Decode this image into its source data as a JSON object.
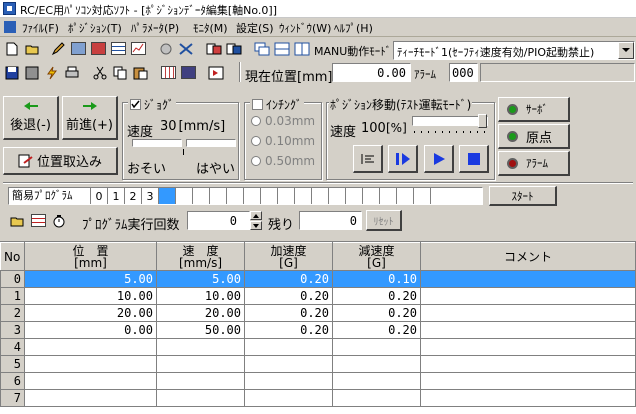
{
  "window": {
    "title": "RC/EC用ﾊﾟｿｺﾝ対応ｿﾌﾄ - [ﾎﾟｼﾞｼｮﾝﾃﾞｰﾀ編集[軸No.0]]"
  },
  "menu": [
    "ﾌｧｲﾙ(F)",
    "ﾎﾟｼﾞｼｮﾝ(T)",
    "ﾊﾟﾗﾒｰﾀ(P)",
    "ﾓﾆﾀ(M)",
    "設定(S)",
    "ｳｨﾝﾄﾞｳ(W)",
    "ﾍﾙﾌﾟ(H)"
  ],
  "toolbar": {
    "manu_mode_label": "MANU動作ﾓｰﾄﾞ",
    "manu_mode_value": "ﾃｨｰﾁﾓｰﾄﾞ1(ｾｰﾌﾃｨ速度有効/PIO起動禁止)",
    "position_label": "現在位置[mm]",
    "position_value": "0.00",
    "alarm_label": "ｱﾗｰﾑ",
    "alarm_value": "000"
  },
  "jog": {
    "back_label": "後退(-)",
    "fwd_label": "前進(+)",
    "fetch_label": "位置取込み",
    "jog_check_label": "ｼﾞｮｸﾞ",
    "speed_label": "速度",
    "speed_value": "30",
    "speed_unit": "[mm/s]",
    "slow_label": "おそい",
    "fast_label": "はやい"
  },
  "inching": {
    "label": "ｲﾝﾁﾝｸﾞ",
    "options": [
      "0.03mm",
      "0.10mm",
      "0.50mm"
    ]
  },
  "posmove": {
    "title": "ﾎﾟｼﾞｼｮﾝ移動(ﾃｽﾄ運転ﾓｰﾄﾞ)",
    "speed_label": "速度",
    "speed_value": "100",
    "speed_unit": "[%]"
  },
  "status": {
    "servo_label": "ｻｰﾎﾞ",
    "origin_label": "原点",
    "alarm_label": "ｱﾗｰﾑ",
    "led_green": "#1a9a1a",
    "led_red": "#a01010"
  },
  "program": {
    "label": "簡易ﾌﾟﾛｸﾞﾗﾑ",
    "steps": [
      "0",
      "1",
      "2",
      "3"
    ],
    "start_label": "ｽﾀｰﾄ",
    "exec_count_label": "ﾌﾟﾛｸﾞﾗﾑ実行回数",
    "exec_count_value": "0",
    "remain_label": "残り",
    "remain_value": "0",
    "reset_label": "ﾘｾｯﾄ"
  },
  "table": {
    "headers": [
      {
        "l1": "No",
        "l2": ""
      },
      {
        "l1": "位　置",
        "l2": "[mm]"
      },
      {
        "l1": "速　度",
        "l2": "[mm/s]"
      },
      {
        "l1": "加速度",
        "l2": "[G]"
      },
      {
        "l1": "減速度",
        "l2": "[G]"
      },
      {
        "l1": "コメント",
        "l2": ""
      }
    ],
    "rows": [
      {
        "no": "0",
        "pos": "5.00",
        "spd": "5.00",
        "acc": "0.20",
        "dec": "0.10",
        "cmt": ""
      },
      {
        "no": "1",
        "pos": "10.00",
        "spd": "10.00",
        "acc": "0.20",
        "dec": "0.20",
        "cmt": ""
      },
      {
        "no": "2",
        "pos": "20.00",
        "spd": "20.00",
        "acc": "0.20",
        "dec": "0.20",
        "cmt": ""
      },
      {
        "no": "3",
        "pos": "0.00",
        "spd": "50.00",
        "acc": "0.20",
        "dec": "0.20",
        "cmt": ""
      },
      {
        "no": "4",
        "pos": "",
        "spd": "",
        "acc": "",
        "dec": "",
        "cmt": ""
      },
      {
        "no": "5",
        "pos": "",
        "spd": "",
        "acc": "",
        "dec": "",
        "cmt": ""
      },
      {
        "no": "6",
        "pos": "",
        "spd": "",
        "acc": "",
        "dec": "",
        "cmt": ""
      },
      {
        "no": "7",
        "pos": "",
        "spd": "",
        "acc": "",
        "dec": "",
        "cmt": ""
      }
    ],
    "selected_row": 0,
    "selection_color": "#3399ff"
  }
}
